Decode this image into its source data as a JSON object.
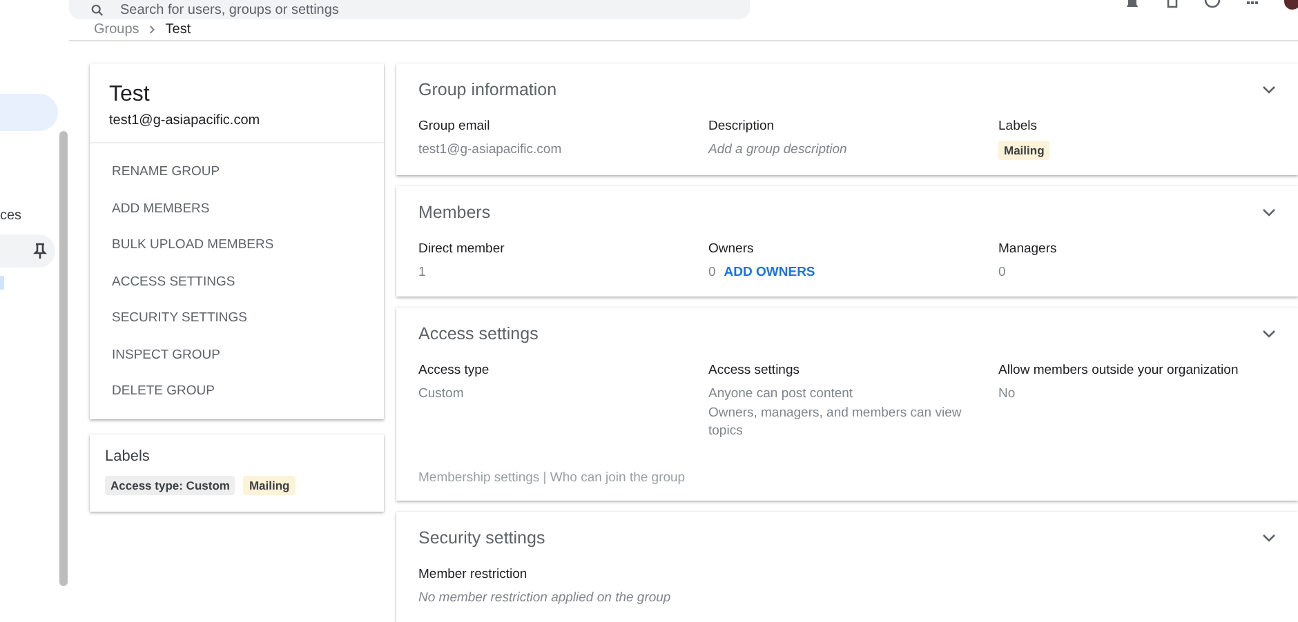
{
  "search": {
    "placeholder": "Search for users, groups or settings"
  },
  "sidebar": {
    "partial_label": "ces"
  },
  "breadcrumb": [
    {
      "label": "Groups"
    },
    {
      "label": "Test"
    }
  ],
  "group": {
    "name": "Test",
    "email": "test1@g-asiapacific.com",
    "actions": [
      {
        "label": "RENAME GROUP"
      },
      {
        "label": "ADD MEMBERS"
      },
      {
        "label": "BULK UPLOAD MEMBERS"
      },
      {
        "label": "ACCESS SETTINGS"
      },
      {
        "label": "SECURITY SETTINGS"
      },
      {
        "label": "INSPECT GROUP"
      },
      {
        "label": "DELETE GROUP"
      }
    ]
  },
  "labels_card": {
    "title": "Labels",
    "labels": [
      {
        "text": "Access type: Custom",
        "color": "#eeeeee"
      },
      {
        "text": "Mailing",
        "color": "#fdf3d8"
      }
    ]
  },
  "sections": [
    {
      "title": "Group information",
      "fields": [
        {
          "label": "Group email",
          "kind": "text",
          "values": [
            "test1@g-asiapacific.com"
          ]
        },
        {
          "label": "Description",
          "kind": "hint",
          "values": [
            "Add a group description"
          ]
        },
        {
          "label": "Labels",
          "kind": "tag",
          "values": [
            "Mailing"
          ],
          "color": "#fdf3d8"
        }
      ]
    },
    {
      "title": "Members",
      "fields": [
        {
          "label": "Direct member",
          "kind": "text",
          "values": [
            "1"
          ]
        },
        {
          "label": "Owners",
          "kind": "text",
          "values": [
            "0"
          ],
          "link": "ADD OWNERS"
        },
        {
          "label": "Managers",
          "kind": "text",
          "values": [
            "0"
          ]
        }
      ]
    },
    {
      "title": "Access settings",
      "fields": [
        {
          "label": "Access type",
          "kind": "text",
          "values": [
            "Custom"
          ]
        },
        {
          "label": "Access settings",
          "kind": "text",
          "values": [
            "Anyone can post content",
            "Owners, managers, and members can view topics"
          ]
        },
        {
          "label": "Allow members outside your organization",
          "kind": "text",
          "values": [
            "No"
          ]
        }
      ],
      "footer": "Membership settings | Who can join the group"
    },
    {
      "title": "Security settings",
      "fields": [
        {
          "label": "Member restriction",
          "kind": "hint",
          "values": [
            "No member restriction applied on the group"
          ]
        }
      ]
    }
  ]
}
